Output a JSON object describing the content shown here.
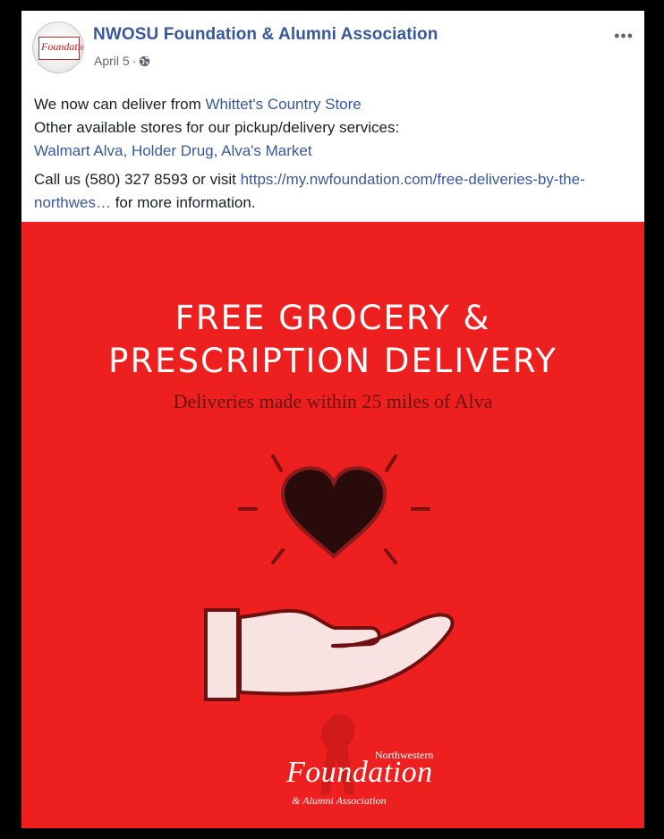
{
  "post": {
    "page_name": "NWOSU Foundation & Alumni Association",
    "date": "April 5",
    "separator": " · ",
    "more_icon": "more-options-icon",
    "avatar_text": "Foundation"
  },
  "message": {
    "line1_prefix": "We now can deliver from ",
    "line1_link": "Whittet's Country Store",
    "line2": "Other available stores for our pickup/delivery services:",
    "line3_link": "Walmart Alva, Holder Drug, Alva's Market",
    "line4_prefix": "Call us (580) 327 8593 or visit ",
    "line4_link": "https://my.nwfoundation.com/free-deliveries-by-the-northwes…",
    "line4_suffix": " for more information."
  },
  "promo": {
    "title_line1": "FREE GROCERY &",
    "title_line2": "PRESCRIPTION DELIVERY",
    "subtitle": "Deliveries made within 25 miles of Alva",
    "logo_small": "Northwestern",
    "logo_main": "Foundation",
    "logo_sub": "& Alumni Association",
    "background_color": "#ee1f1f"
  }
}
